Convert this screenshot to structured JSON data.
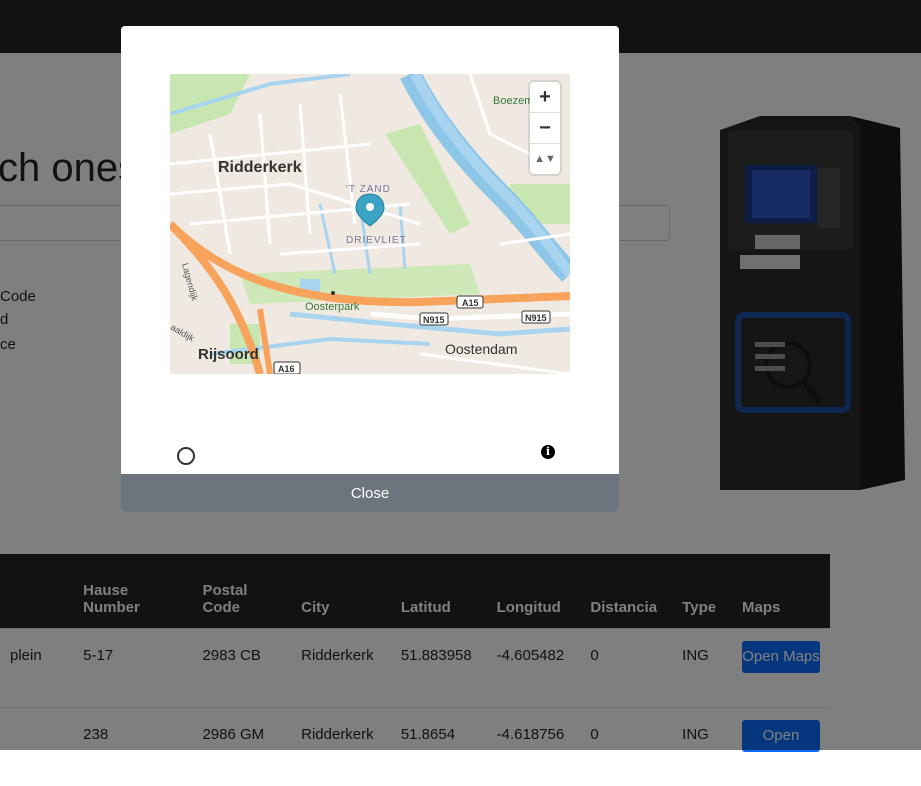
{
  "hero": {
    "title_fragment": "ch ones"
  },
  "side_labels": [
    "Code",
    "d",
    "ce"
  ],
  "table": {
    "headers": [
      "",
      "Hause Number",
      "Postal Code",
      "City",
      "Latitud",
      "Longitud",
      "Distancia",
      "Type",
      "Maps"
    ],
    "rows": [
      {
        "street": "plein",
        "number": "5-17",
        "postal": "2983 CB",
        "city": "Ridderkerk",
        "lat": "51.883958",
        "lon": "-4.605482",
        "dist": "0",
        "type": "ING",
        "button": "Open Maps"
      },
      {
        "street": "",
        "number": "238",
        "postal": "2986 GM",
        "city": "Ridderkerk",
        "lat": "51.8654",
        "lon": "-4.618756",
        "dist": "0",
        "type": "ING",
        "button": "Open"
      }
    ]
  },
  "modal": {
    "map": {
      "labels": {
        "ridderkerk": "Ridderkerk",
        "t_zand": "'T ZAND",
        "drievliet": "DRIEVLIET",
        "oosterpark": "Oosterpark",
        "rijsoord": "Rijsoord",
        "oostendam": "Oostendam",
        "boezem": "Boezem",
        "lagendijk": "Lagendijk",
        "waaldijk": "aaldijk",
        "a15": "A15",
        "a16": "A16",
        "n915_a": "N915",
        "n915_b": "N915"
      },
      "zoom_in": "+",
      "zoom_out": "−",
      "compass": "▲▼"
    },
    "info_glyph": "i",
    "close_label": "Close"
  }
}
